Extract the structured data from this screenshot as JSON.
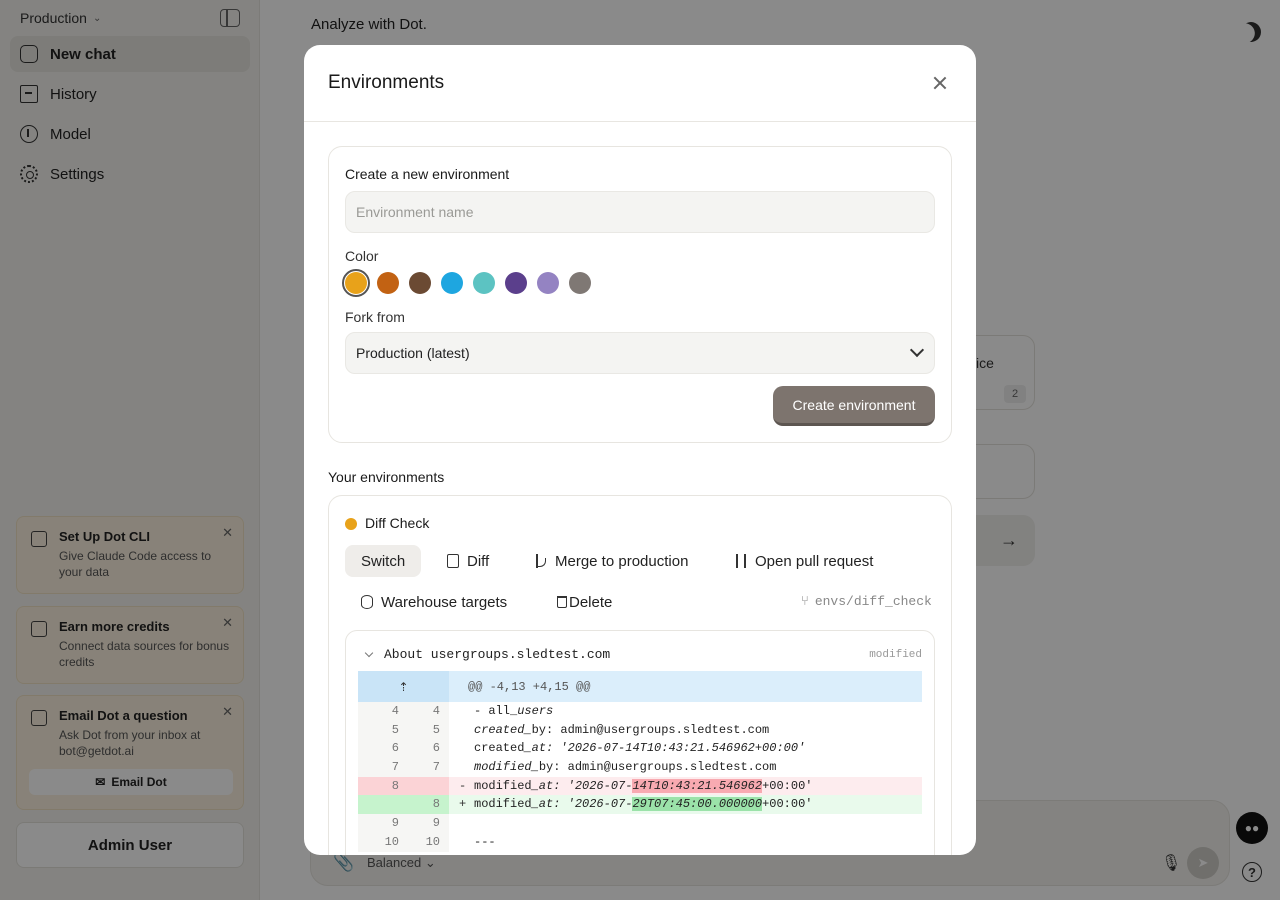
{
  "sidebar": {
    "workspace": "Production",
    "nav": [
      {
        "label": "New chat",
        "icon": "chat-bubble-icon"
      },
      {
        "label": "History",
        "icon": "archive-icon"
      },
      {
        "label": "Model",
        "icon": "model-icon"
      },
      {
        "label": "Settings",
        "icon": "gear-icon"
      }
    ],
    "promos": [
      {
        "title": "Set Up Dot CLI",
        "desc": "Give Claude Code access to your data"
      },
      {
        "title": "Earn more credits",
        "desc": "Connect data sources for bonus credits"
      },
      {
        "title": "Email Dot a question",
        "desc": "Ask Dot from your inbox at bot@getdot.ai",
        "button": "Email Dot"
      }
    ],
    "user": "Admin User"
  },
  "main": {
    "title": "Analyze with Dot.",
    "bg_card_fragment": "ice",
    "bg_card_badge": "2",
    "composer_mode": "Balanced"
  },
  "modal": {
    "title": "Environments",
    "create": {
      "heading": "Create a new environment",
      "name_placeholder": "Environment name",
      "color_label": "Color",
      "colors": [
        "#e8a21a",
        "#c26213",
        "#6b4a33",
        "#1ea6e0",
        "#5cc3c2",
        "#5b3f8c",
        "#9483c2",
        "#7f7874"
      ],
      "selected_color": "#e8a21a",
      "fork_label": "Fork from",
      "fork_value": "Production (latest)",
      "button": "Create environment"
    },
    "your_envs_heading": "Your environments",
    "env": {
      "name": "Diff Check",
      "dot_color": "#e8a21a",
      "actions": [
        "Switch",
        "Diff",
        "Merge to production",
        "Open pull request",
        "Warehouse targets",
        "Delete"
      ],
      "branch": "envs/diff_check",
      "diff": {
        "file": "About usergroups.sledtest.com",
        "status": "modified",
        "hunk": "@@ -4,13 +4,15 @@",
        "lines": [
          {
            "old": "4",
            "new": "4",
            "sign": "",
            "pre": "- all_",
            "it": "users",
            "post": "",
            "type": "ctx"
          },
          {
            "old": "5",
            "new": "5",
            "sign": "",
            "pre": "",
            "it": "created_",
            "post": "by: admin@usergroups.sledtest.com",
            "type": "ctx"
          },
          {
            "old": "6",
            "new": "6",
            "sign": "",
            "pre": "created",
            "it": "_at: '2026-07-14T10:43:21.546962+00:00'",
            "post": "",
            "type": "ctx"
          },
          {
            "old": "7",
            "new": "7",
            "sign": "",
            "pre": "",
            "it": "modified_",
            "post": "by: admin@usergroups.sledtest.com",
            "type": "ctx"
          },
          {
            "old": "8",
            "new": "",
            "sign": "-",
            "pre": "modified",
            "it": "_at: '2026-07-",
            "hl": "14T10:43:21.546962",
            "post": "+00:00'",
            "type": "del"
          },
          {
            "old": "",
            "new": "8",
            "sign": "+",
            "pre": "modified",
            "it": "_at: '2026-07-",
            "hl": "29T07:45:00.000000",
            "post": "+00:00'",
            "type": "add"
          },
          {
            "old": "9",
            "new": "9",
            "sign": "",
            "pre": "",
            "it": "",
            "post": "",
            "type": "ctx"
          },
          {
            "old": "10",
            "new": "10",
            "sign": "",
            "pre": "---",
            "it": "",
            "post": "",
            "type": "ctx"
          }
        ]
      }
    }
  }
}
